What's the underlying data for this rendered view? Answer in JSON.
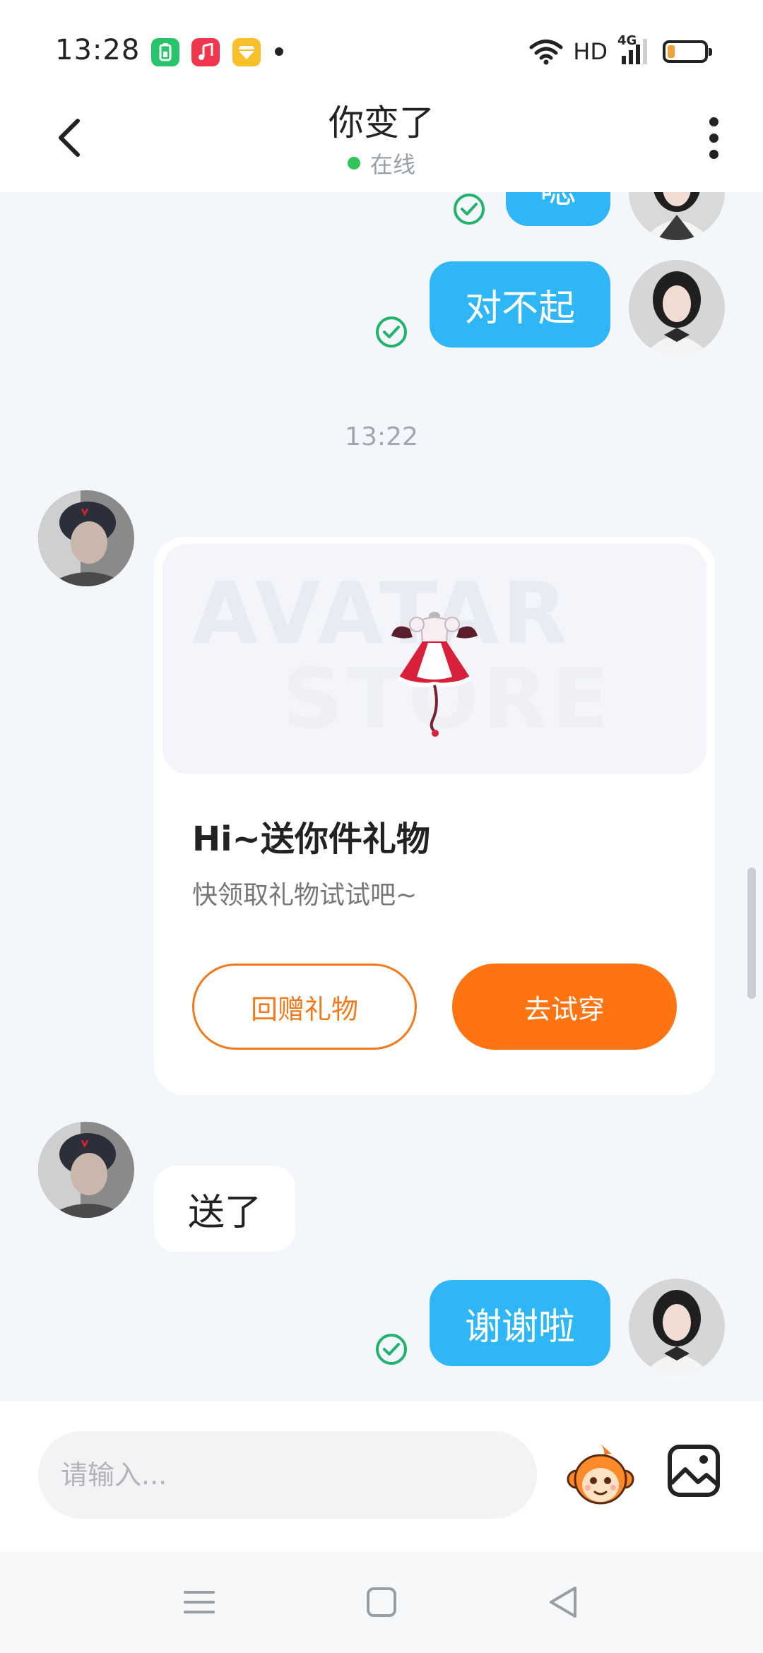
{
  "status_bar": {
    "time": "13:28",
    "apps": [
      "battery-app-icon",
      "music-app-icon",
      "diamond-app-icon"
    ],
    "network": "HD",
    "signal": "4G"
  },
  "header": {
    "title": "你变了",
    "status": "在线",
    "status_color": "#30c45a"
  },
  "messages": [
    {
      "from": "me",
      "text": "嗯",
      "status": "read"
    },
    {
      "from": "me",
      "text": "对不起",
      "status": "read"
    },
    {
      "type": "time",
      "text": "13:22"
    },
    {
      "from": "other",
      "type": "gift",
      "image_watermark": [
        "AVATAR",
        "STORE"
      ],
      "title": "Hi~送你件礼物",
      "subtitle": "快领取礼物试试吧~",
      "button_return": "回赠礼物",
      "button_try": "去试穿"
    },
    {
      "from": "other",
      "text": "送了"
    },
    {
      "from": "me",
      "text": "谢谢啦",
      "status": "read"
    }
  ],
  "input": {
    "placeholder": "请输入..."
  },
  "colors": {
    "my_bubble": "#2fb6f7",
    "accent_orange": "#ff7411",
    "read_check": "#21b36b"
  }
}
